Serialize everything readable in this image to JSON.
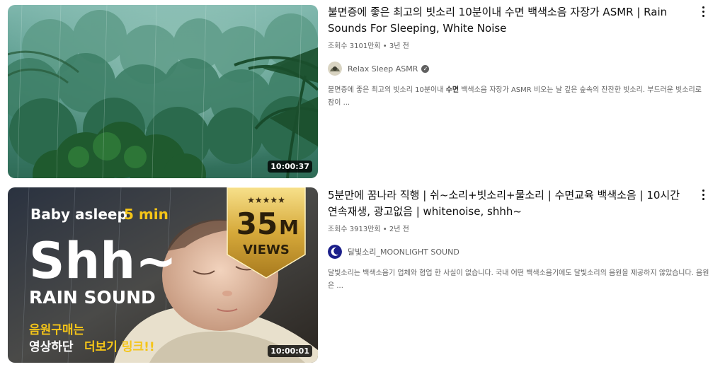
{
  "results": [
    {
      "title": "불면증에 좋은 최고의 빗소리 10분이내 수면 백색소음 자장가 ASMR | Rain Sounds For Sleeping, White Noise",
      "meta": "조회수 3101만회 • 3년 전",
      "channel": "Relax Sleep ASMR",
      "verified": true,
      "description_pre": "불면증에 좋은 최고의 빗소리 10분이내 ",
      "description_bold": "수면",
      "description_post": " 백색소음 자장가 ASMR 비오는 날 깊은 숲속의 잔잔한 빗소리. 부드러운 빗소리로 잠이 ...",
      "duration": "10:00:37"
    },
    {
      "title": "5분만에 꿈나라 직행 | 쉬~소리+빗소리+물소리 | 수면교육 백색소음  | 10시간 연속재생, 광고없음 | whitenoise, shhh~",
      "meta": "조회수 3913만회 • 2년 전",
      "channel": "달빛소리_MOONLIGHT SOUND",
      "verified": false,
      "description": "달빛소리는 백색소음기 업체와 협업 한 사실이 없습니다. 국내 어떤 백색소음기에도 달빛소리의 음원을 제공하지 않았습니다. 음원은 ...",
      "duration": "10:00:01",
      "thumbnail_text": {
        "top": "Baby asleep",
        "top_accent": "5 min",
        "big": "Shh~",
        "sub": "RAIN SOUND",
        "badge_stars": "★★★★★",
        "badge_number": "35",
        "badge_unit": "M",
        "badge_views": "VIEWS",
        "footer_line1": "음원구매는",
        "footer_line2_a": "영상하단",
        "footer_line2_b": "더보기 링크!!"
      }
    }
  ]
}
